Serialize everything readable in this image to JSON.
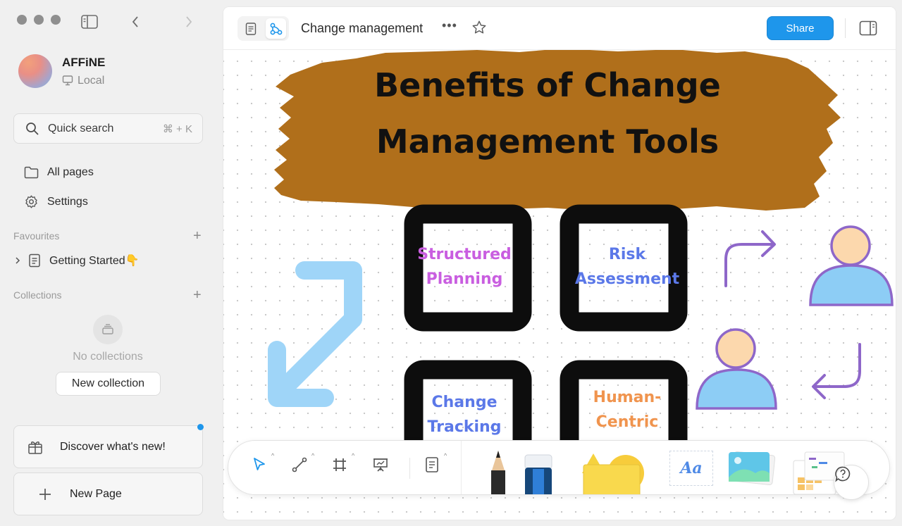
{
  "sidebar": {
    "workspace": {
      "name": "AFFiNE",
      "storage": "Local"
    },
    "search": {
      "label": "Quick search",
      "shortcut": "⌘ + K"
    },
    "nav": [
      {
        "label": "All pages",
        "icon": "folder-icon"
      },
      {
        "label": "Settings",
        "icon": "gear-icon"
      }
    ],
    "favourites": {
      "title": "Favourites",
      "items": [
        {
          "label": "Getting Started👇"
        }
      ]
    },
    "collections": {
      "title": "Collections",
      "empty_text": "No collections",
      "new_button": "New collection"
    },
    "discover": "Discover what's new!",
    "new_page": "New Page"
  },
  "header": {
    "title": "Change management",
    "more": "•••",
    "share": "Share"
  },
  "canvas": {
    "banner_line1": "Benefits of Change",
    "banner_line2": "Management Tools",
    "tiles": [
      {
        "line1": "Structured",
        "line2": "Planning",
        "color": "#c95ee0"
      },
      {
        "line1": "Risk",
        "line2": "Assessment",
        "color": "#5b78e8"
      },
      {
        "line1": "Change",
        "line2": "Tracking",
        "color": "#5b78e8"
      },
      {
        "line1": "Human-",
        "line2": "Centric",
        "color": "#f0944e"
      }
    ],
    "colors": {
      "banner": "#b06f1b",
      "arrow": "#9fd5f8",
      "person_fill": "#8dcdf5",
      "person_head": "#fcd8ad",
      "person_stroke": "#8e67c9"
    }
  },
  "toolbar": {
    "text_tool": "Aa"
  }
}
